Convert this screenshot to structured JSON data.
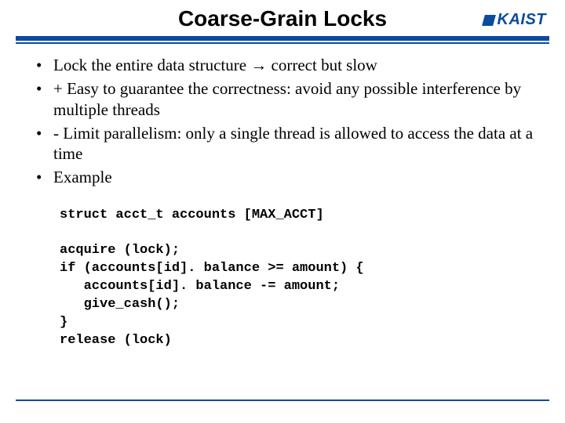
{
  "header": {
    "title": "Coarse-Grain Locks",
    "logo_text": "KAIST"
  },
  "bullets": [
    "Lock the entire data structure → correct but slow",
    "+ Easy to guarantee the correctness: avoid any possible interference by multiple threads",
    "- Limit parallelism: only a single thread is allowed to access the data at a time",
    "Example"
  ],
  "code": {
    "line1": "struct acct_t accounts [MAX_ACCT]",
    "blank1": "",
    "line2": "acquire (lock);",
    "line3": "if (accounts[id]. balance >= amount) {",
    "line4": "   accounts[id]. balance -= amount;",
    "line5": "   give_cash();",
    "line6": "}",
    "line7": "release (lock)"
  },
  "colors": {
    "accent": "#0a4b9f"
  }
}
